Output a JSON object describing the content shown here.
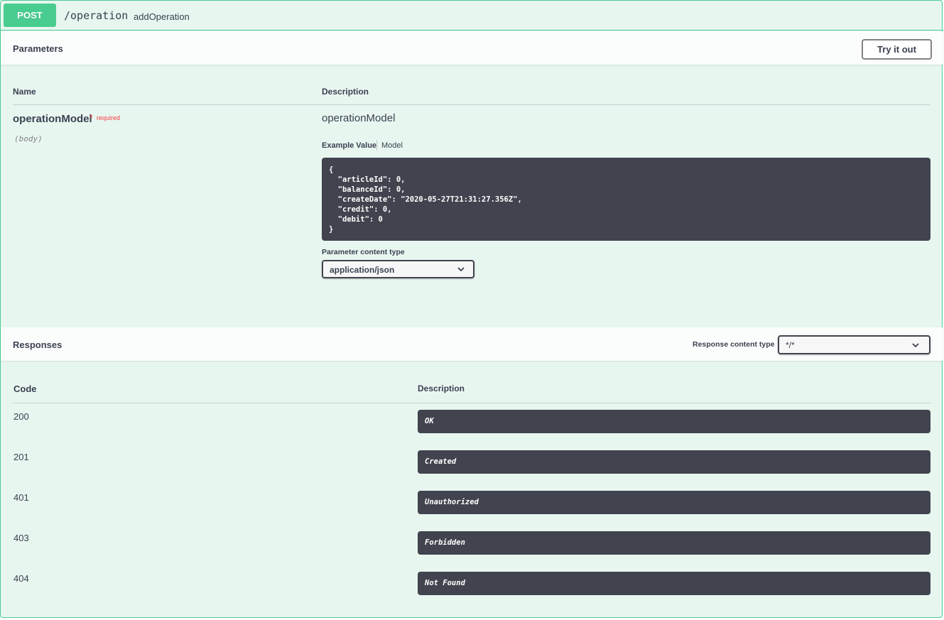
{
  "operation": {
    "method": "POST",
    "path": "/operation",
    "operation_id": "addOperation"
  },
  "parameters": {
    "title": "Parameters",
    "try_it_out": "Try it out",
    "col_name": "Name",
    "col_description": "Description",
    "param_name": "operationModel",
    "required_star": "*",
    "required_text": "required",
    "param_in": "(body)",
    "param_description": "operationModel",
    "tab_example": "Example Value",
    "tab_model": "Model",
    "example_json": "{\n  \"articleId\": 0,\n  \"balanceId\": 0,\n  \"createDate\": \"2020-05-27T21:31:27.356Z\",\n  \"credit\": 0,\n  \"debit\": 0\n}",
    "content_type_label": "Parameter content type",
    "content_type_value": "application/json"
  },
  "responses": {
    "title": "Responses",
    "content_type_label": "Response content type",
    "content_type_value": "*/*",
    "col_code": "Code",
    "col_description": "Description",
    "rows": [
      {
        "code": "200",
        "description": "OK"
      },
      {
        "code": "201",
        "description": "Created"
      },
      {
        "code": "401",
        "description": "Unauthorized"
      },
      {
        "code": "403",
        "description": "Forbidden"
      },
      {
        "code": "404",
        "description": "Not Found"
      }
    ]
  },
  "colors": {
    "post_green": "#49cc90",
    "block_bg": "#e8f6f0",
    "code_bg": "#41444e",
    "required_red": "#f93e3e"
  }
}
